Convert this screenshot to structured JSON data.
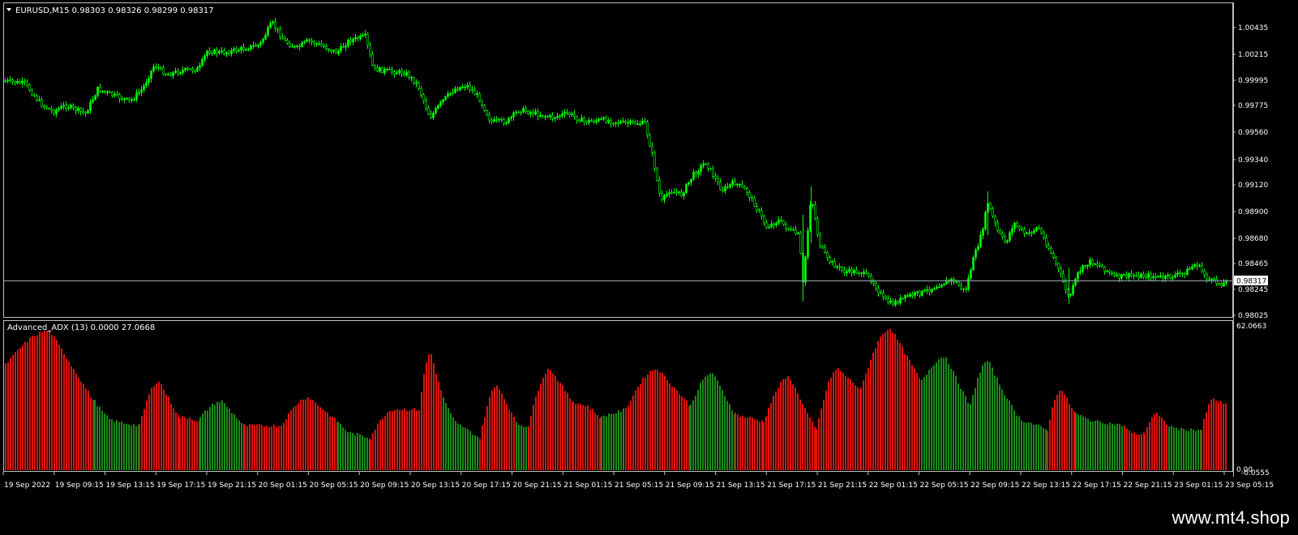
{
  "main_chart": {
    "symbol_header": "EURUSD,M15  0.98303 0.98326 0.98299 0.98317",
    "current_price": "0.98317",
    "price_ticks": [
      "1.00435",
      "1.00215",
      "0.99995",
      "0.99775",
      "0.99560",
      "0.99340",
      "0.99120",
      "0.98900",
      "0.98680",
      "0.98465",
      "0.98245",
      "0.98025"
    ],
    "y_range": [
      0.9798,
      1.0056
    ],
    "candle_color": "#00ff00",
    "price_line_color": "#9aa8b8"
  },
  "indicator": {
    "header": "Advanced_ADX (13) 0.0000 27.0668",
    "top_value": "62.0663",
    "zero_label": "0.00",
    "zero_label_2": "-0.0555",
    "colors": {
      "up": "#1a8c1a",
      "down": "#e0140f"
    }
  },
  "time_axis": {
    "labels": [
      "19 Sep 2022",
      "19 Sep 09:15",
      "19 Sep 13:15",
      "19 Sep 17:15",
      "19 Sep 21:15",
      "20 Sep 01:15",
      "20 Sep 05:15",
      "20 Sep 09:15",
      "20 Sep 13:15",
      "20 Sep 17:15",
      "20 Sep 21:15",
      "21 Sep 01:15",
      "21 Sep 05:15",
      "21 Sep 09:15",
      "21 Sep 13:15",
      "21 Sep 17:15",
      "21 Sep 21:15",
      "22 Sep 01:15",
      "22 Sep 05:15",
      "22 Sep 09:15",
      "22 Sep 13:15",
      "22 Sep 17:15",
      "22 Sep 21:15",
      "23 Sep 01:15",
      "23 Sep 05:15"
    ]
  },
  "footer": {
    "site": "www.mt4.shop"
  }
}
